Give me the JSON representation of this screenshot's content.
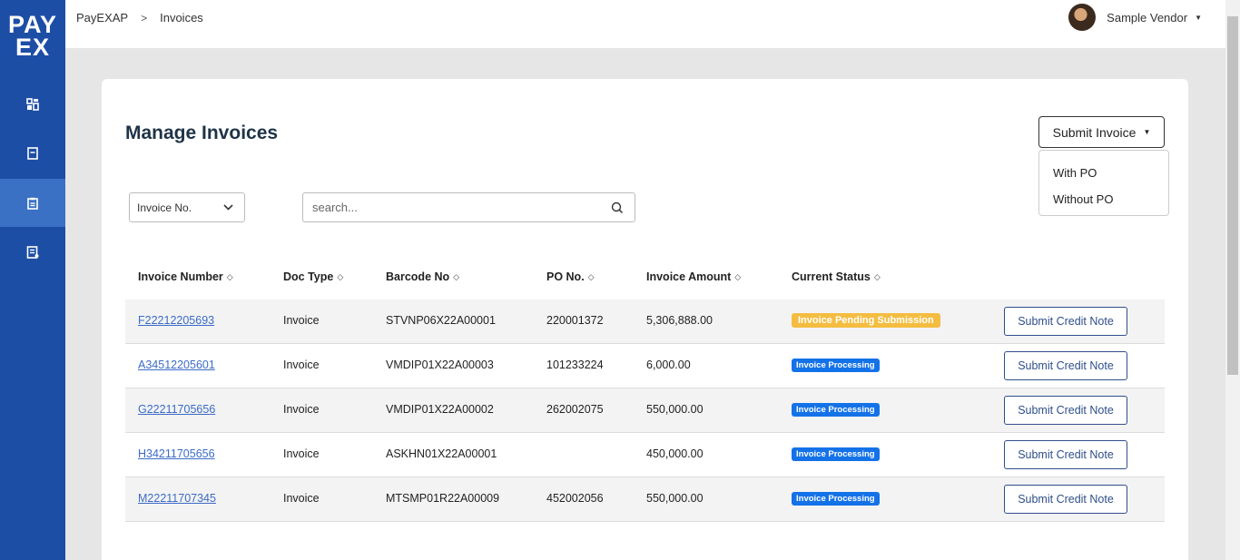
{
  "sidebar": {
    "logo_top": "PAY",
    "logo_bottom": "EX",
    "items": [
      {
        "icon": "dashboard-icon"
      },
      {
        "icon": "document-icon"
      },
      {
        "icon": "clipboard-icon",
        "active": true
      },
      {
        "icon": "report-icon"
      }
    ]
  },
  "breadcrumb": {
    "root": "PayEXAP",
    "separator": ">",
    "current": "Invoices"
  },
  "user": {
    "name": "Sample Vendor"
  },
  "page": {
    "title": "Manage Invoices"
  },
  "submit_invoice": {
    "label": "Submit Invoice",
    "options": [
      "With PO",
      "Without PO"
    ]
  },
  "filter": {
    "selected": "Invoice No."
  },
  "search": {
    "placeholder": "search..."
  },
  "table": {
    "headers": [
      "Invoice Number",
      "Doc Type",
      "Barcode No",
      "PO No.",
      "Invoice Amount",
      "Current Status"
    ],
    "rows": [
      {
        "invoice": "F22212205693",
        "doc_type": "Invoice",
        "barcode": "STVNP06X22A00001",
        "po": "220001372",
        "amount": "5,306,888.00",
        "status": "Invoice Pending Submission",
        "action": "Submit Credit Note"
      },
      {
        "invoice": "A34512205601",
        "doc_type": "Invoice",
        "barcode": "VMDIP01X22A00003",
        "po": "101233224",
        "amount": "6,000.00",
        "status": "Invoice Processing",
        "action": "Submit Credit Note"
      },
      {
        "invoice": "G22211705656",
        "doc_type": "Invoice",
        "barcode": "VMDIP01X22A00002",
        "po": "262002075",
        "amount": "550,000.00",
        "status": "Invoice Processing",
        "action": "Submit Credit Note"
      },
      {
        "invoice": "H34211705656",
        "doc_type": "Invoice",
        "barcode": "ASKHN01X22A00001",
        "po": "",
        "amount": "450,000.00",
        "status": "Invoice Processing",
        "action": "Submit Credit Note"
      },
      {
        "invoice": "M22211707345",
        "doc_type": "Invoice",
        "barcode": "MTSMP01R22A00009",
        "po": "452002056",
        "amount": "550,000.00",
        "status": "Invoice Processing",
        "action": "Submit Credit Note"
      }
    ]
  },
  "colors": {
    "sidebar": "#1d4ea6",
    "sidebar_active": "#3a71c4",
    "status_pending": "#f4bd41",
    "status_processing": "#1472e8",
    "link": "#3b6bc8"
  }
}
